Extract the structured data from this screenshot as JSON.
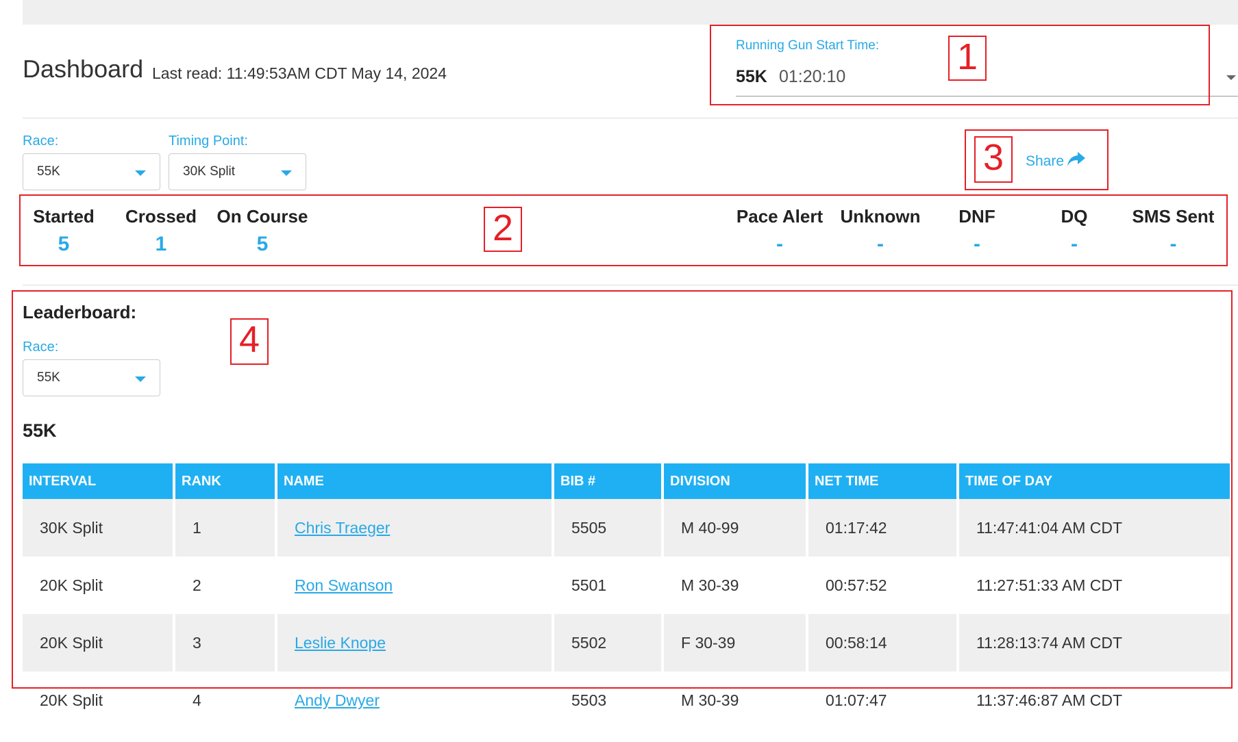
{
  "header": {
    "title": "Dashboard",
    "last_read": "Last read: 11:49:53AM CDT May 14, 2024"
  },
  "gun_start": {
    "label": "Running Gun Start Time:",
    "race": "55K",
    "time": "01:20:10"
  },
  "filters": {
    "race_label": "Race:",
    "race_value": "55K",
    "timing_point_label": "Timing Point:",
    "timing_point_value": "30K Split"
  },
  "share": {
    "label": "Share",
    "icon": "share-arrow-icon"
  },
  "stats": {
    "started": {
      "label": "Started",
      "value": "5"
    },
    "crossed": {
      "label": "Crossed",
      "value": "1"
    },
    "on_course": {
      "label": "On Course",
      "value": "5"
    },
    "pace_alert": {
      "label": "Pace Alert",
      "value": "-"
    },
    "unknown": {
      "label": "Unknown",
      "value": "-"
    },
    "dnf": {
      "label": "DNF",
      "value": "-"
    },
    "dq": {
      "label": "DQ",
      "value": "-"
    },
    "sms_sent": {
      "label": "SMS Sent",
      "value": "-"
    }
  },
  "leaderboard": {
    "title": "Leaderboard:",
    "race_label": "Race:",
    "race_value": "55K",
    "race_heading": "55K",
    "columns": [
      "INTERVAL",
      "RANK",
      "NAME",
      "BIB #",
      "DIVISION",
      "NET TIME",
      "TIME OF DAY"
    ],
    "rows": [
      {
        "interval": "30K Split",
        "rank": "1",
        "name": "Chris Traeger",
        "bib": "5505",
        "division": "M 40-99",
        "net_time": "01:17:42",
        "time_of_day": "11:47:41:04 AM CDT"
      },
      {
        "interval": "20K Split",
        "rank": "2",
        "name": "Ron Swanson",
        "bib": "5501",
        "division": "M 30-39",
        "net_time": "00:57:52",
        "time_of_day": "11:27:51:33 AM CDT"
      },
      {
        "interval": "20K Split",
        "rank": "3",
        "name": "Leslie Knope",
        "bib": "5502",
        "division": "F 30-39",
        "net_time": "00:58:14",
        "time_of_day": "11:28:13:74 AM CDT"
      },
      {
        "interval": "20K Split",
        "rank": "4",
        "name": "Andy Dwyer",
        "bib": "5503",
        "division": "M 30-39",
        "net_time": "01:07:47",
        "time_of_day": "11:37:46:87 AM CDT"
      }
    ]
  },
  "annotations": [
    "1",
    "2",
    "3",
    "4"
  ],
  "colors": {
    "accent": "#29a9e6",
    "header_bg": "#1fb0f3",
    "annotation": "#e52027"
  }
}
